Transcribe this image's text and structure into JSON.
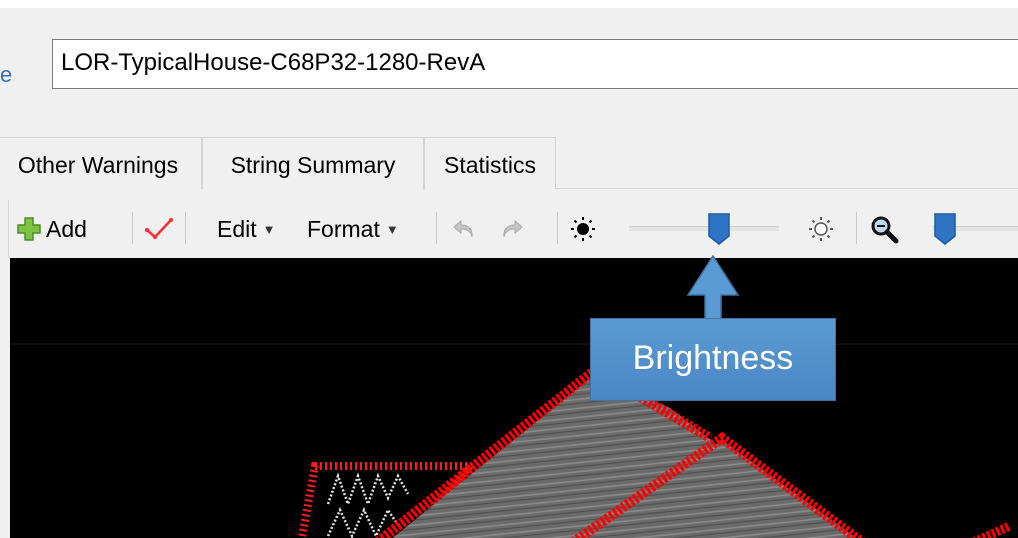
{
  "document": {
    "name_value": "LOR-TypicalHouse-C68P32-1280-RevA",
    "left_glyph": "e"
  },
  "tabs": [
    {
      "label": "Other Warnings"
    },
    {
      "label": "String Summary"
    },
    {
      "label": "Statistics"
    }
  ],
  "toolbar": {
    "add_label": "Add",
    "edit_label": "Edit",
    "format_label": "Format",
    "brightness_level": 0.6,
    "zoom_level": 0.1
  },
  "callout": {
    "label": "Brightness"
  },
  "colors": {
    "accent": "#2d74c4",
    "callout": "#5b9bd5",
    "outline": "#ff0000",
    "canvas": "#000000",
    "add_icon": "#7dc243"
  },
  "icons": [
    "plus-icon",
    "checkmark-icon",
    "undo-icon",
    "redo-icon",
    "brightness-low-icon",
    "brightness-high-icon",
    "zoom-icon"
  ]
}
